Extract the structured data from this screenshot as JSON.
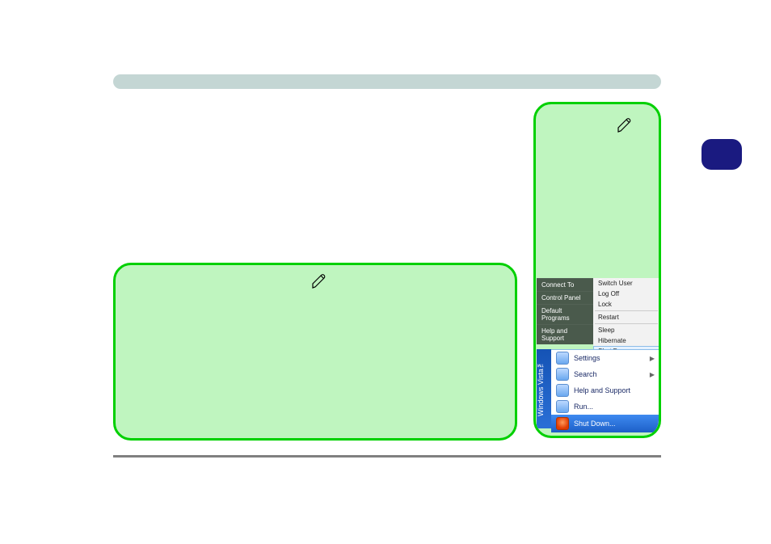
{
  "vista_left_items": [
    "Connect To",
    "Control Panel",
    "Default Programs",
    "Help and Support"
  ],
  "vista_right_items": [
    "Switch User",
    "Log Off",
    "Lock",
    "Restart",
    "Sleep",
    "Hibernate",
    "Shut Down"
  ],
  "vista_highlight_index": 6,
  "xp_side_label": "Windows Vista™",
  "xp_items": [
    {
      "label": "Settings",
      "arrow": true
    },
    {
      "label": "Search",
      "arrow": true
    },
    {
      "label": "Help and Support",
      "arrow": false
    },
    {
      "label": "Run...",
      "arrow": false
    }
  ],
  "xp_shutdown_label": "Shut Down..."
}
